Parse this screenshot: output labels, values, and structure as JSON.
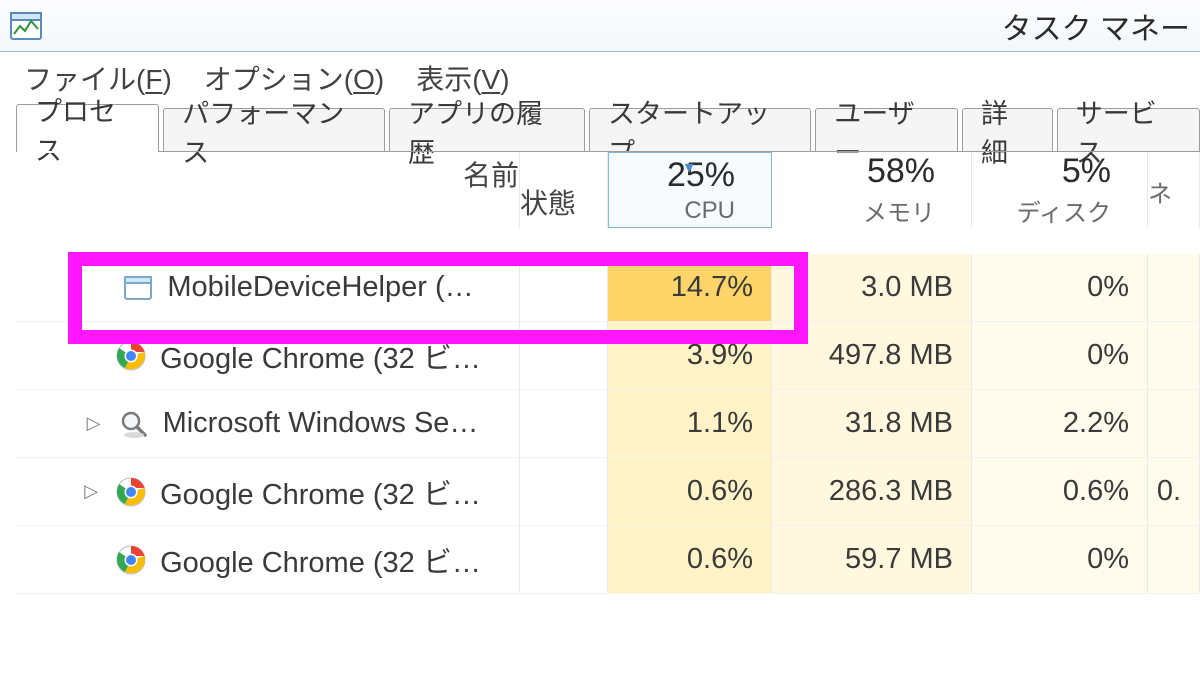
{
  "window": {
    "title": "タスク マネー"
  },
  "menu": {
    "file": "ファイル(F)",
    "options": "オプション(O)",
    "view": "表示(V)"
  },
  "tabs": [
    "プロセス",
    "パフォーマンス",
    "アプリの履歴",
    "スタートアップ",
    "ユーザー",
    "詳細",
    "サービス"
  ],
  "active_tab": 0,
  "columns": {
    "name": {
      "label": "名前"
    },
    "status": {
      "label": "状態"
    },
    "cpu": {
      "pct": "25%",
      "label": "CPU",
      "sorted": "desc"
    },
    "mem": {
      "pct": "58%",
      "label": "メモリ"
    },
    "disk": {
      "pct": "5%",
      "label": "ディスク"
    },
    "net": {
      "pct": "",
      "label": "ネ"
    }
  },
  "processes": [
    {
      "icon": "window",
      "name": "MobileDeviceHelper (…",
      "cpu": "14.7%",
      "mem": "3.0 MB",
      "disk": "0%",
      "net": "",
      "expandable": false,
      "hot": true
    },
    {
      "icon": "chrome",
      "name": "Google Chrome (32 ビ…",
      "cpu": "3.9%",
      "mem": "497.8 MB",
      "disk": "0%",
      "net": "",
      "expandable": false
    },
    {
      "icon": "search",
      "name": "Microsoft Windows Se…",
      "cpu": "1.1%",
      "mem": "31.8 MB",
      "disk": "2.2%",
      "net": "",
      "expandable": true
    },
    {
      "icon": "chrome",
      "name": "Google Chrome (32 ビ…",
      "cpu": "0.6%",
      "mem": "286.3 MB",
      "disk": "0.6%",
      "net": "0.",
      "expandable": true
    },
    {
      "icon": "chrome",
      "name": "Google Chrome (32 ビ…",
      "cpu": "0.6%",
      "mem": "59.7 MB",
      "disk": "0%",
      "net": "",
      "expandable": false
    }
  ],
  "annotation": {
    "visible": true
  }
}
